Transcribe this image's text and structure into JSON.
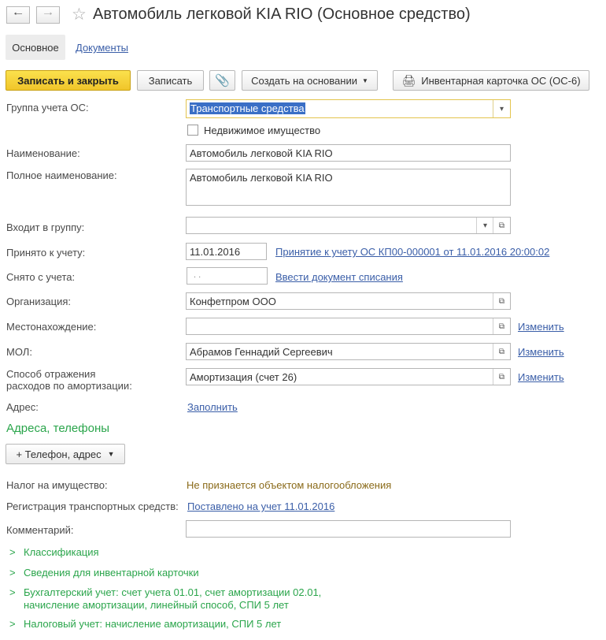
{
  "header": {
    "back_icon": "arrow-left-icon",
    "forward_icon": "arrow-right-icon",
    "star_icon": "star-icon",
    "title": "Автомобиль легковой KIA RIO (Основное средство)"
  },
  "tabs": {
    "main": "Основное",
    "documents": "Документы"
  },
  "toolbar": {
    "save_close": "Записать и закрыть",
    "save": "Записать",
    "attach_icon": "paperclip-icon",
    "create_based": "Создать на основании",
    "print_icon": "printer-icon",
    "inventory_card": "Инвентарная карточка ОС (ОС-6)"
  },
  "form": {
    "group_label": "Группа учета ОС:",
    "group_value": "Транспортные средства",
    "real_estate_label": "Недвижимое имущество",
    "name_label": "Наименование:",
    "name_value": "Автомобиль легковой KIA RIO",
    "fullname_label": "Полное наименование:",
    "fullname_value": "Автомобиль легковой KIA RIO",
    "parent_label": "Входит в группу:",
    "parent_value": "",
    "accepted_label": "Принято к учету:",
    "accepted_value": "11.01.2016",
    "accepted_link": "Принятие к учету ОС КП00-000001 от 11.01.2016 20:00:02",
    "removed_label": "Снято с учета:",
    "removed_value": ". .",
    "removed_link": "Ввести документ списания",
    "org_label": "Организация:",
    "org_value": "Конфетпром ООО",
    "location_label": "Местонахождение:",
    "location_value": "",
    "location_change": "Изменить",
    "mol_label": "МОЛ:",
    "mol_value": "Абрамов Геннадий Сергеевич",
    "mol_change": "Изменить",
    "amort_label_1": "Способ отражения",
    "amort_label_2": "расходов по амортизации:",
    "amort_value": "Амортизация (счет 26)",
    "amort_change": "Изменить",
    "address_label": "Адрес:",
    "address_link": "Заполнить"
  },
  "contacts": {
    "section_title": "Адреса, телефоны",
    "add_button": "+ Телефон, адрес"
  },
  "tax": {
    "property_tax_label": "Налог на имущество:",
    "property_tax_value": "Не признается объектом налогообложения",
    "registration_label": "Регистрация транспортных средств:",
    "registration_link": "Поставлено на учет 11.01.2016",
    "comment_label": "Комментарий:",
    "comment_value": ""
  },
  "groups": [
    "Классификация",
    "Сведения для инвентарной карточки",
    "Бухгалтерский учет: счет учета 01.01, счет амортизации 02.01,",
    "начисление амортизации, линейный способ, СПИ 5 лет",
    "Налоговый учет: начисление амортизации, СПИ 5 лет"
  ],
  "colors": {
    "primary_button": "#f3cb2f",
    "link": "#3a5ea8",
    "section_green": "#2aa54b",
    "selection": "#3a6fc6",
    "olive_text": "#8a6a19"
  }
}
